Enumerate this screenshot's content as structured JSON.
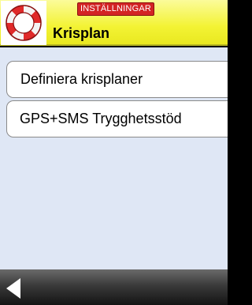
{
  "header": {
    "section_badge": "INSTÄLLNINGAR",
    "title": "Krisplan",
    "icon": "lifebuoy-icon"
  },
  "menu": {
    "items": [
      {
        "label": "Definiera krisplaner"
      },
      {
        "label": "GPS+SMS Trygghetsstöd"
      }
    ]
  },
  "footer": {
    "back_icon": "back-arrow-icon"
  },
  "colors": {
    "header_yellow": "#f3f334",
    "badge_red": "#d32424",
    "content_background": "#dfe7f5",
    "footer_dark": "#2a2a2a"
  }
}
